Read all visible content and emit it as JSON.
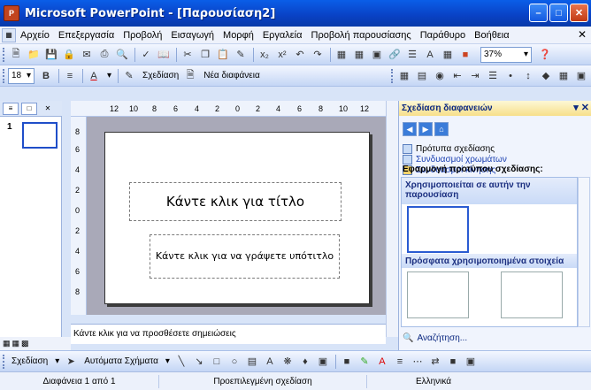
{
  "window": {
    "title": "Microsoft PowerPoint - [Παρουσίαση2]",
    "app_icon": "powerpoint-icon"
  },
  "menubar": {
    "items": [
      "Αρχείο",
      "Επεξεργασία",
      "Προβολή",
      "Εισαγωγή",
      "Μορφή",
      "Εργαλεία",
      "Προβολή παρουσίασης",
      "Παράθυρο",
      "Βοήθεια"
    ]
  },
  "toolbar": {
    "zoom": "37%"
  },
  "format_toolbar": {
    "font_size": "18",
    "design_label": "Σχεδίαση",
    "new_slide_label": "Νέα διαφάνεια"
  },
  "ruler": {
    "h_ticks": [
      "12",
      "10",
      "8",
      "6",
      "4",
      "2",
      "0",
      "2",
      "4",
      "6",
      "8",
      "10",
      "12"
    ],
    "v_ticks": [
      "8",
      "6",
      "4",
      "2",
      "0",
      "2",
      "4",
      "6",
      "8"
    ]
  },
  "slide_panel": {
    "slide_number": "1"
  },
  "slide": {
    "title_placeholder": "Κάντε κλικ για τίτλο",
    "subtitle_placeholder": "Κάντε κλικ για να γράψετε υπότιτλο"
  },
  "notes": {
    "placeholder": "Κάντε κλικ για να προσθέσετε σημειώσεις"
  },
  "taskpane": {
    "title": "Σχεδίαση διαφανειών",
    "links": [
      "Πρότυπα σχεδίασης",
      "Συνδυασμοί χρωμάτων",
      "Συνδυασμοί κίνησης"
    ],
    "section_title": "Εφαρμογή προτύπου σχεδίασης:",
    "group1": "Χρησιμοποιείται σε αυτήν την παρουσίαση",
    "group2": "Πρόσφατα χρησιμοποιημένα στοιχεία",
    "search": "Αναζήτηση..."
  },
  "drawbar": {
    "draw_label": "Σχεδίαση",
    "autoshapes_label": "Αυτόματα Σχήματα"
  },
  "statusbar": {
    "slide_info": "Διαφάνεια 1 από 1",
    "design": "Προεπιλεγμένη σχεδίαση",
    "language": "Ελληνικά"
  }
}
